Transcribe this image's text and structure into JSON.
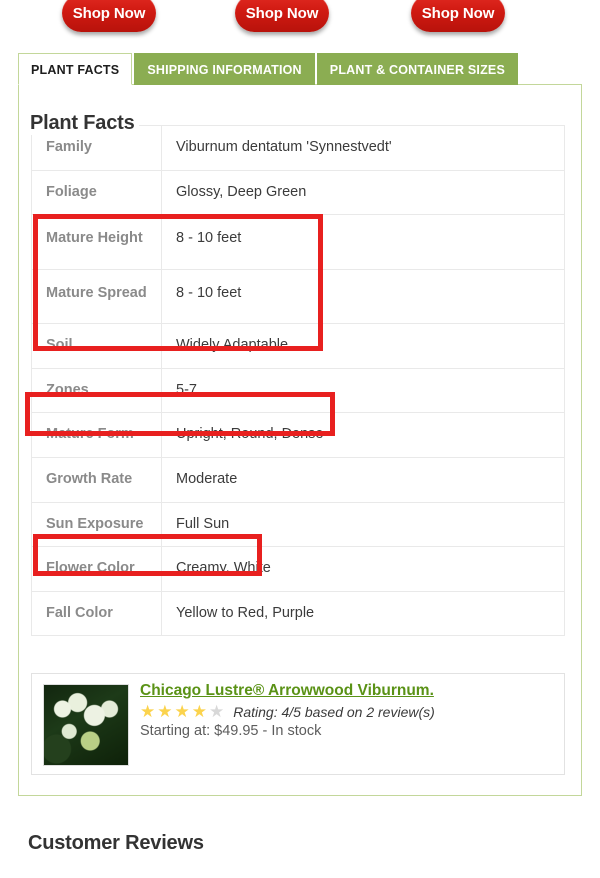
{
  "promo": {
    "buttons": [
      {
        "label": "Shop Now"
      },
      {
        "label": "Shop Now"
      },
      {
        "label": "Shop Now"
      }
    ]
  },
  "tabs": [
    {
      "label": "PLANT FACTS",
      "active": true
    },
    {
      "label": "SHIPPING INFORMATION",
      "active": false
    },
    {
      "label": "PLANT & CONTAINER SIZES",
      "active": false
    }
  ],
  "panel": {
    "title": "Plant Facts",
    "facts": [
      {
        "label": "Family",
        "value": "Viburnum dentatum 'Synnestvedt'"
      },
      {
        "label": "Foliage",
        "value": "Glossy, Deep Green"
      },
      {
        "label": "Mature Height",
        "value": "8 - 10 feet"
      },
      {
        "label": "Mature Spread",
        "value": "8 - 10 feet"
      },
      {
        "label": "Soil",
        "value": "Widely Adaptable"
      },
      {
        "label": "Zones",
        "value": "5-7"
      },
      {
        "label": "Mature Form",
        "value": "Upright, Round, Dense"
      },
      {
        "label": "Growth Rate",
        "value": "Moderate"
      },
      {
        "label": "Sun Exposure",
        "value": "Full Sun"
      },
      {
        "label": "Flower Color",
        "value": "Creamy, White"
      },
      {
        "label": "Fall Color",
        "value": "Yellow to Red, Purple"
      }
    ]
  },
  "product": {
    "name": "Chicago Lustre® Arrowwood Viburnum.",
    "stars_filled": 4,
    "stars_total": 5,
    "rating_text": "Rating: 4/5 based on 2 review(s)",
    "price_text": "Starting at: $49.95 - In stock"
  },
  "reviews": {
    "heading": "Customer Reviews"
  },
  "annotations": [
    {
      "name": "mature-height-spread-highlight",
      "color": "#e8201f"
    },
    {
      "name": "zones-highlight",
      "color": "#e8201f"
    },
    {
      "name": "sun-exposure-highlight",
      "color": "#e8201f"
    }
  ],
  "colors": {
    "tab_green": "#8bad52",
    "panel_border": "#c3d79a",
    "shop_red": "#d01a12",
    "product_link_green": "#5a9216",
    "star_gold": "#fbd34d",
    "annotation_red": "#e8201f"
  }
}
